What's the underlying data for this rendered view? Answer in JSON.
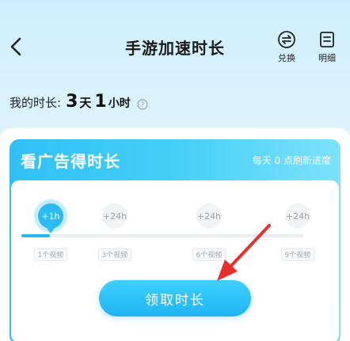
{
  "header": {
    "title": "手游加速时长",
    "exchange_label": "兑换",
    "detail_label": "明细"
  },
  "my_time": {
    "label": "我的时长:",
    "days_value": "3",
    "days_unit": "天",
    "hours_value": "1",
    "hours_unit": "小时"
  },
  "ad_panel": {
    "title": "看广告得时长",
    "subtitle": "每天 0 点刷新进度",
    "progress": 0.1,
    "steps": [
      {
        "reward": "+1h",
        "videos": "1个视频",
        "active": true
      },
      {
        "reward": "+24h",
        "videos": "3个视频",
        "active": false
      },
      {
        "reward": "+24h",
        "videos": "6个视频",
        "active": false
      },
      {
        "reward": "+24h",
        "videos": "9个视频",
        "active": false
      }
    ],
    "claim_label": "领取时长"
  },
  "colors": {
    "accent": "#2cbcf3",
    "annotation_arrow": "#e8302c"
  },
  "icons": [
    "back-arrow-icon",
    "exchange-icon",
    "detail-list-icon",
    "help-icon"
  ]
}
